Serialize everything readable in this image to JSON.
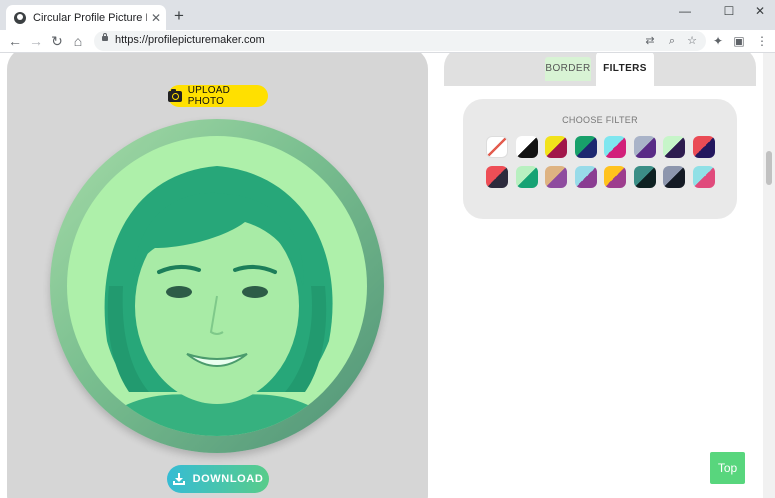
{
  "browser": {
    "tab_title": "Circular Profile Picture Maker",
    "tab_close": "✕",
    "new_tab": "+",
    "url": "https://profilepicturemaker.com",
    "window": {
      "minimize": "—",
      "maximize": "☐",
      "close": "✕"
    },
    "nav": {
      "back": "←",
      "forward": "→",
      "reload": "↻",
      "home": "⌂"
    },
    "omnibox_icons": {
      "translate": "⇄",
      "zoom": "⌕",
      "bookmark": "☆"
    },
    "toolbar_icons": {
      "extensions": "✦",
      "media": "▣",
      "menu": "⋮"
    }
  },
  "editor": {
    "upload_label": "UPLOAD PHOTO",
    "download_label": "DOWNLOAD"
  },
  "tabs": {
    "border_label": "BORDER",
    "filters_label": "FILTERS"
  },
  "filters": {
    "title": "CHOOSE FILTER",
    "swatches": [
      {
        "name": "none",
        "a": "#ffffff",
        "b": "#ffffff",
        "slash": "#e35d4f"
      },
      {
        "name": "black-white",
        "a": "#ffffff",
        "b": "#111111"
      },
      {
        "name": "yellow-crimson",
        "a": "#f2e21b",
        "b": "#a1174a"
      },
      {
        "name": "green-navy",
        "a": "#18a06a",
        "b": "#1d2870"
      },
      {
        "name": "cyan-magenta",
        "a": "#7fe6ef",
        "b": "#d2207a"
      },
      {
        "name": "gray-purple",
        "a": "#a9b3c8",
        "b": "#5a2b86"
      },
      {
        "name": "mint-darkpurple",
        "a": "#c7f5c9",
        "b": "#2e1c4f"
      },
      {
        "name": "red-indigo",
        "a": "#ea4b55",
        "b": "#23175e"
      },
      {
        "name": "red-charcoal",
        "a": "#ee4e56",
        "b": "#2d2b3d"
      },
      {
        "name": "mint-green",
        "a": "#b8f0c0",
        "b": "#16a274"
      },
      {
        "name": "tan-violet",
        "a": "#deb382",
        "b": "#8e4c9f"
      },
      {
        "name": "lightblue-violet",
        "a": "#98dbe9",
        "b": "#8a3d92"
      },
      {
        "name": "gold-purple",
        "a": "#ffc21e",
        "b": "#9d3d8e"
      },
      {
        "name": "teal-dark",
        "a": "#3b8e86",
        "b": "#0e2122"
      },
      {
        "name": "slate-black",
        "a": "#8d96ad",
        "b": "#141a24"
      },
      {
        "name": "aqua-pink",
        "a": "#90e0e6",
        "b": "#e04b7c"
      }
    ]
  },
  "top_button": "Top"
}
